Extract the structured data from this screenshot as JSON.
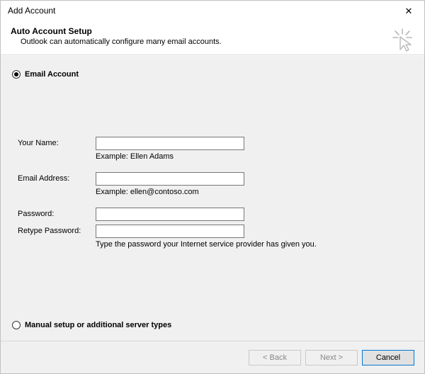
{
  "window": {
    "title": "Add Account"
  },
  "header": {
    "title": "Auto Account Setup",
    "subtitle": "Outlook can automatically configure many email accounts."
  },
  "options": {
    "email_account": {
      "label": "Email Account",
      "selected": true
    },
    "manual_setup": {
      "label": "Manual setup or additional server types",
      "selected": false
    }
  },
  "fields": {
    "your_name": {
      "label": "Your Name:",
      "value": "",
      "example": "Example: Ellen Adams"
    },
    "email_address": {
      "label": "Email Address:",
      "value": "",
      "example": "Example: ellen@contoso.com"
    },
    "password": {
      "label": "Password:",
      "value": ""
    },
    "retype_password": {
      "label": "Retype Password:",
      "value": "",
      "hint": "Type the password your Internet service provider has given you."
    }
  },
  "buttons": {
    "back": "< Back",
    "next": "Next >",
    "cancel": "Cancel"
  },
  "icons": {
    "close": "✕",
    "cursor_click": "cursor-click-icon"
  }
}
